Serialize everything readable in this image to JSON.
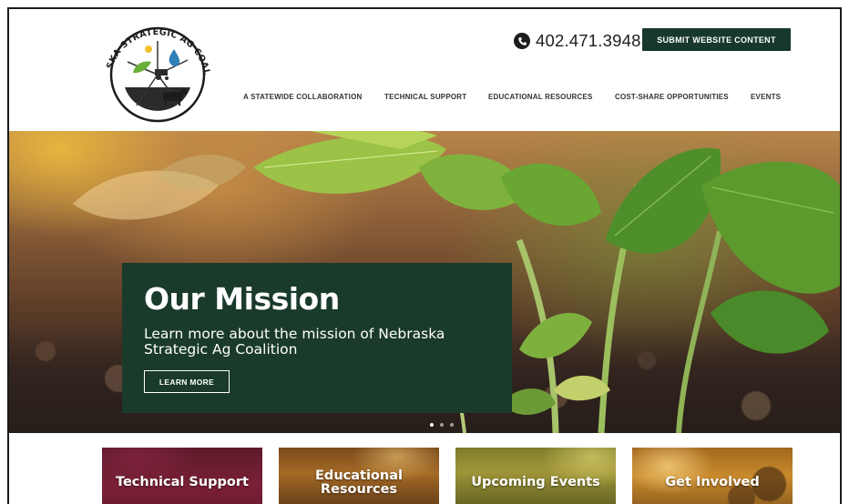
{
  "logo": {
    "text": "NEBRASKA STRATEGIC AG COALITION",
    "colors": {
      "ring": "#1c1c1c",
      "sky": "#2f7fb8",
      "leaf": "#6aae3a",
      "ground": "#2b2b2b"
    }
  },
  "header": {
    "phone_icon": "phone-icon",
    "phone": "402.471.3948",
    "submit_label": "SUBMIT WEBSITE CONTENT",
    "nav": [
      {
        "label": "A STATEWIDE COLLABORATION"
      },
      {
        "label": "TECHNICAL SUPPORT"
      },
      {
        "label": "EDUCATIONAL RESOURCES"
      },
      {
        "label": "COST-SHARE OPPORTUNITIES"
      },
      {
        "label": "EVENTS"
      }
    ]
  },
  "hero": {
    "title": "Our Mission",
    "text": "Learn more about the mission of Nebraska Strategic Ag Coalition",
    "button_label": "LEARN MORE",
    "slide_count": 3,
    "active_slide": 1
  },
  "cards": [
    {
      "label": "Technical Support"
    },
    {
      "label": "Educational Resources"
    },
    {
      "label": "Upcoming Events"
    },
    {
      "label": "Get Involved"
    }
  ],
  "colors": {
    "brand_green": "#17392b",
    "mission_box": "#1a3a2b",
    "text_dark": "#1d1d1d"
  }
}
